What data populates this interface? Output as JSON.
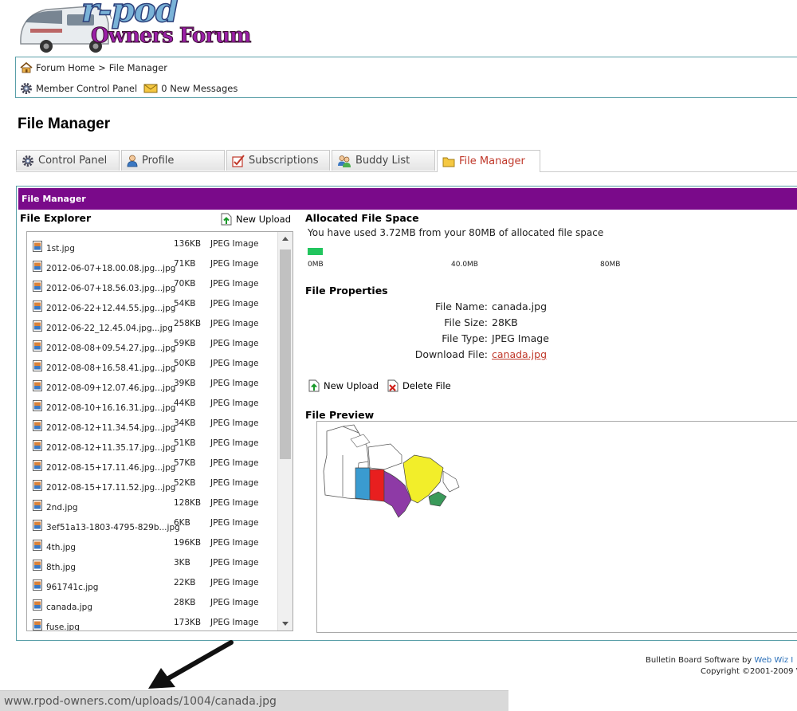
{
  "logo": {
    "line1": "r-pod",
    "line2": "Owners Forum"
  },
  "breadcrumb": {
    "home": "Forum Home",
    "separator": ">",
    "current": "File Manager"
  },
  "member_bar": {
    "control_panel": "Member Control Panel",
    "messages": "0 New Messages"
  },
  "page_title": "File Manager",
  "tabs": [
    {
      "label": "Control Panel",
      "icon": "gear-icon"
    },
    {
      "label": "Profile",
      "icon": "user-icon"
    },
    {
      "label": "Subscriptions",
      "icon": "checklist-icon"
    },
    {
      "label": "Buddy List",
      "icon": "buddies-icon"
    },
    {
      "label": "File Manager",
      "icon": "folder-icon",
      "active": true
    }
  ],
  "panel": {
    "header": "File Manager",
    "explorer_title": "File Explorer",
    "new_upload": "New Upload"
  },
  "files": [
    {
      "name": "1st.jpg",
      "size": "136KB",
      "type": "JPEG Image"
    },
    {
      "name": "2012-06-07+18.00.08.jpg...jpg",
      "size": "71KB",
      "type": "JPEG Image"
    },
    {
      "name": "2012-06-07+18.56.03.jpg...jpg",
      "size": "70KB",
      "type": "JPEG Image"
    },
    {
      "name": "2012-06-22+12.44.55.jpg...jpg",
      "size": "54KB",
      "type": "JPEG Image"
    },
    {
      "name": "2012-06-22_12.45.04.jpg...jpg",
      "size": "258KB",
      "type": "JPEG Image"
    },
    {
      "name": "2012-08-08+09.54.27.jpg...jpg",
      "size": "59KB",
      "type": "JPEG Image"
    },
    {
      "name": "2012-08-08+16.58.41.jpg...jpg",
      "size": "50KB",
      "type": "JPEG Image"
    },
    {
      "name": "2012-08-09+12.07.46.jpg...jpg",
      "size": "39KB",
      "type": "JPEG Image"
    },
    {
      "name": "2012-08-10+16.16.31.jpg...jpg",
      "size": "44KB",
      "type": "JPEG Image"
    },
    {
      "name": "2012-08-12+11.34.54.jpg...jpg",
      "size": "34KB",
      "type": "JPEG Image"
    },
    {
      "name": "2012-08-12+11.35.17.jpg...jpg",
      "size": "51KB",
      "type": "JPEG Image"
    },
    {
      "name": "2012-08-15+17.11.46.jpg...jpg",
      "size": "57KB",
      "type": "JPEG Image"
    },
    {
      "name": "2012-08-15+17.11.52.jpg...jpg",
      "size": "52KB",
      "type": "JPEG Image"
    },
    {
      "name": "2nd.jpg",
      "size": "128KB",
      "type": "JPEG Image"
    },
    {
      "name": "3ef51a13-1803-4795-829b...jpg",
      "size": "6KB",
      "type": "JPEG Image"
    },
    {
      "name": "4th.jpg",
      "size": "196KB",
      "type": "JPEG Image"
    },
    {
      "name": "8th.jpg",
      "size": "3KB",
      "type": "JPEG Image"
    },
    {
      "name": "961741c.jpg",
      "size": "22KB",
      "type": "JPEG Image"
    },
    {
      "name": "canada.jpg",
      "size": "28KB",
      "type": "JPEG Image"
    },
    {
      "name": "fuse.jpg",
      "size": "173KB",
      "type": "JPEG Image"
    }
  ],
  "allocated": {
    "title": "Allocated File Space",
    "text": "You have used 3.72MB from your 80MB of allocated file space",
    "used_fraction": 0.0465,
    "ticks": [
      "0MB",
      "40.0MB",
      "80MB"
    ],
    "bar_color": "#22c55e"
  },
  "properties": {
    "title": "File Properties",
    "rows": [
      {
        "label": "File Name:",
        "value": "canada.jpg"
      },
      {
        "label": "File Size:",
        "value": "28KB"
      },
      {
        "label": "File Type:",
        "value": "JPEG Image"
      },
      {
        "label": "Download File:",
        "value": "canada.jpg"
      }
    ]
  },
  "actions": {
    "new_upload": "New Upload",
    "delete_file": "Delete File"
  },
  "preview": {
    "title": "File Preview"
  },
  "footer": {
    "line1_prefix": "Bulletin Board Software by",
    "line1_link": "Web Wiz I",
    "line2": "Copyright ©2001-2009 V"
  },
  "statusbar": {
    "url": "www.rpod-owners.com/uploads/1004/canada.jpg"
  },
  "colors": {
    "header_purple": "#7a0a8a",
    "link_red": "#c0392b",
    "border_teal": "#5a9fa8"
  }
}
